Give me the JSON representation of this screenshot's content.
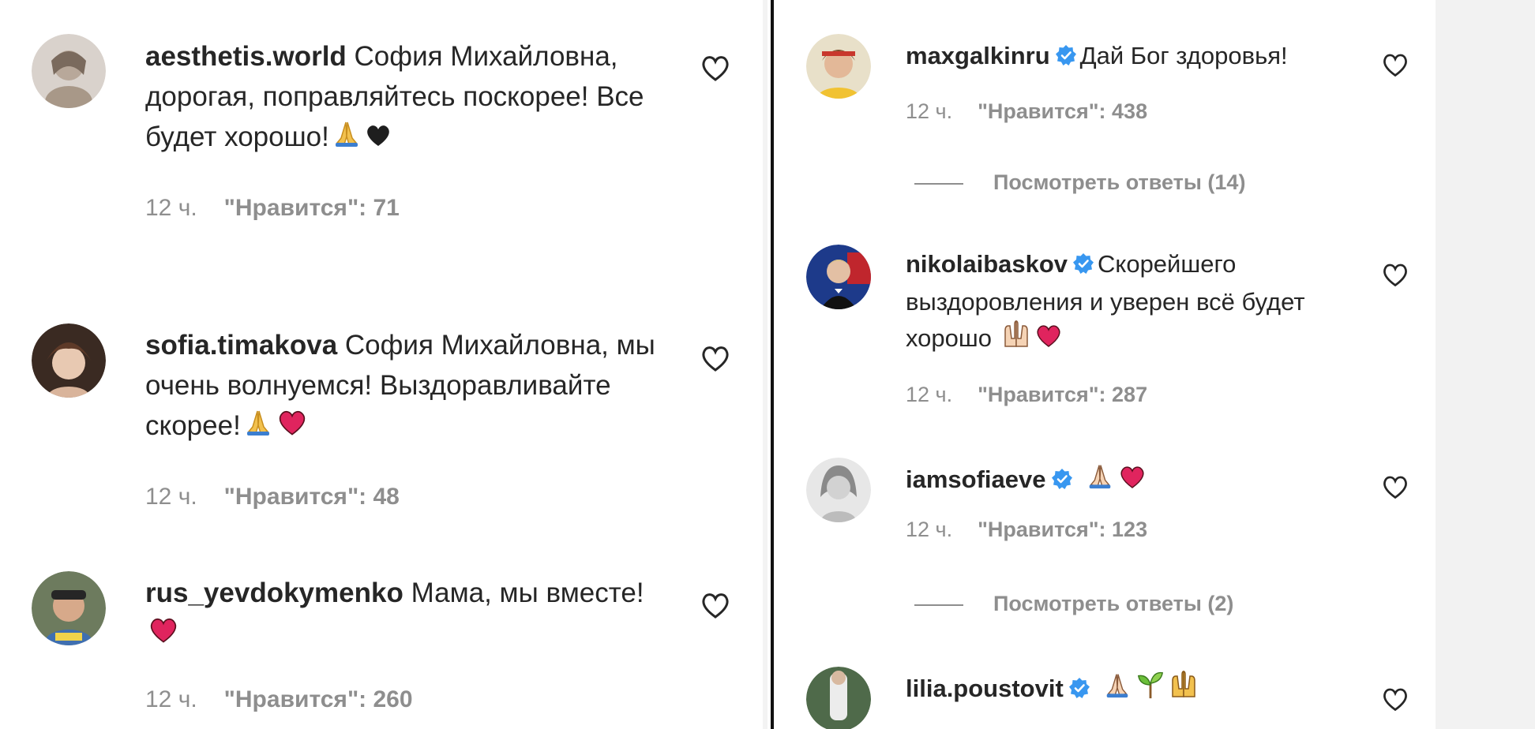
{
  "left_comments": [
    {
      "username": "aesthetis.world",
      "text": "София Михайловна, дорогая, поправляйтесь поскорее! Все будет хорошо!",
      "emojis": [
        "folded-hands",
        "black-heart"
      ],
      "time": "12 ч.",
      "likes": "\"Нравится\": 71",
      "verified": false
    },
    {
      "username": "sofia.timakova",
      "text": "София Михайловна, мы очень волнуемся! Выздоравливайте скорее!",
      "emojis": [
        "folded-hands",
        "red-heart"
      ],
      "time": "12 ч.",
      "likes": "\"Нравится\": 48",
      "verified": false
    },
    {
      "username": "rus_yevdokymenko",
      "text": "Мама, мы вместе!",
      "emojis": [
        "red-heart"
      ],
      "time": "12 ч.",
      "likes": "\"Нравится\": 260",
      "verified": false
    }
  ],
  "right_comments": [
    {
      "username": "maxgalkinru",
      "text": "Дай Бог здоровья!",
      "emojis": [],
      "time": "12 ч.",
      "likes": "\"Нравится\": 438",
      "verified": true,
      "replies": "Посмотреть ответы (14)"
    },
    {
      "username": "nikolaibaskov",
      "text": "Скорейшего выздоровления и уверен всё будет хорошо",
      "emojis": [
        "raised-hands",
        "red-heart"
      ],
      "time": "12 ч.",
      "likes": "\"Нравится\": 287",
      "verified": true
    },
    {
      "username": "iamsofiaeve",
      "text": "",
      "emojis": [
        "folded-hands",
        "red-heart"
      ],
      "time": "12 ч.",
      "likes": "\"Нравится\": 123",
      "verified": true,
      "replies": "Посмотреть ответы (2)"
    },
    {
      "username": "lilia.poustovit",
      "text": "",
      "emojis": [
        "folded-hands",
        "seedling",
        "raised-hands"
      ],
      "verified": true
    }
  ],
  "colors": {
    "text": "#262626",
    "meta": "#8e8e8e",
    "verified": "#3897f0",
    "heart": "#e0245e",
    "divider": "#111111"
  }
}
